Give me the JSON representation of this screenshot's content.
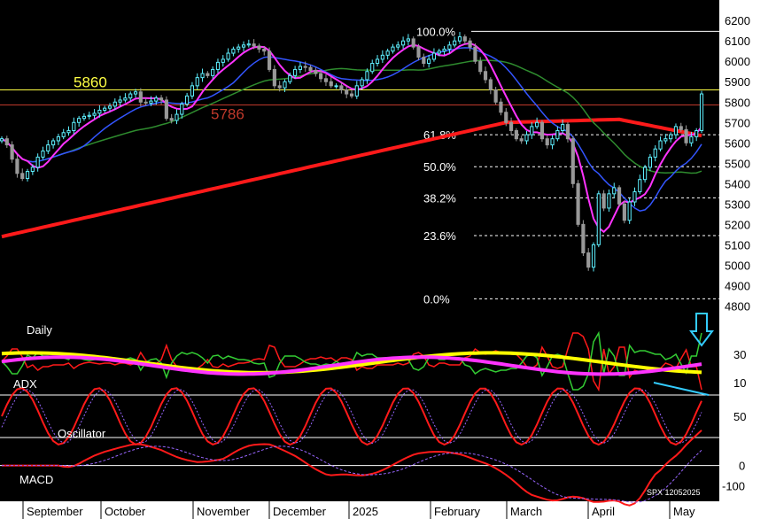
{
  "chart_data": [
    {
      "type": "candlestick",
      "series_name": "SPX",
      "yticks": [
        4800,
        4900,
        5000,
        5100,
        5200,
        5300,
        5400,
        5500,
        5600,
        5700,
        5800,
        5900,
        6000,
        6100,
        6200
      ],
      "ylim": [
        4780,
        6240
      ],
      "months": [
        "September",
        "October",
        "November",
        "December",
        "2025",
        "February",
        "March",
        "April",
        "May"
      ],
      "levels": [
        {
          "value": 6147,
          "label": "",
          "color": "#ffffff"
        },
        {
          "value": 5860,
          "label": "5860",
          "color": "#ffff44"
        },
        {
          "value": 5786,
          "label": "5786",
          "color": "#c0392b"
        }
      ],
      "fib_levels": [
        {
          "label": "100.0%",
          "value": 6147
        },
        {
          "label": "61.8%",
          "value": 5640
        },
        {
          "label": "50.0%",
          "value": 5483
        },
        {
          "label": "38.2%",
          "value": 5330
        },
        {
          "label": "23.6%",
          "value": 5145
        },
        {
          "label": "0.0%",
          "value": 4835
        }
      ],
      "close": [
        5620,
        5590,
        5520,
        5450,
        5425,
        5460,
        5480,
        5530,
        5560,
        5590,
        5610,
        5630,
        5650,
        5660,
        5700,
        5720,
        5730,
        5735,
        5745,
        5760,
        5770,
        5780,
        5800,
        5810,
        5820,
        5840,
        5850,
        5800,
        5795,
        5805,
        5820,
        5810,
        5720,
        5710,
        5740,
        5790,
        5830,
        5880,
        5920,
        5940,
        5930,
        5960,
        5995,
        6010,
        6040,
        6060,
        6070,
        6080,
        6085,
        6075,
        6060,
        6050,
        5960,
        5880,
        5870,
        5900,
        5930,
        5960,
        5975,
        5970,
        5955,
        5940,
        5915,
        5900,
        5880,
        5880,
        5860,
        5840,
        5830,
        5880,
        5910,
        5950,
        5990,
        6010,
        6030,
        6050,
        6070,
        6080,
        6100,
        6110,
        6070,
        6020,
        5990,
        6010,
        6040,
        6050,
        6060,
        6080,
        6100,
        6120,
        6100,
        6070,
        6000,
        5950,
        5910,
        5860,
        5800,
        5750,
        5700,
        5660,
        5620,
        5610,
        5640,
        5680,
        5700,
        5620,
        5590,
        5620,
        5660,
        5690,
        5620,
        5400,
        5200,
        5060,
        4990,
        5100,
        5350,
        5280,
        5350,
        5380,
        5300,
        5220,
        5310,
        5360,
        5420,
        5480,
        5530,
        5570,
        5610,
        5620,
        5640,
        5680,
        5665,
        5600,
        5630,
        5660,
        5840
      ]
    },
    {
      "type": "line",
      "panel": "Daily ADX",
      "yticks": [
        10,
        30
      ],
      "ylim": [
        0,
        50
      ]
    },
    {
      "type": "line",
      "panel": "Oscillator",
      "yticks": [
        50
      ],
      "ylim": [
        0,
        100
      ],
      "levels": [
        80,
        20
      ]
    },
    {
      "type": "line",
      "panel": "MACD",
      "yticks": [
        -100,
        0
      ],
      "ylim": [
        -160,
        60
      ],
      "note": "SPX 12052025"
    }
  ],
  "labels": {
    "daily": "Daily",
    "adx": "ADX",
    "oscillator": "Oscillator",
    "macd": "MACD",
    "footnote": "SPX 12052025"
  }
}
